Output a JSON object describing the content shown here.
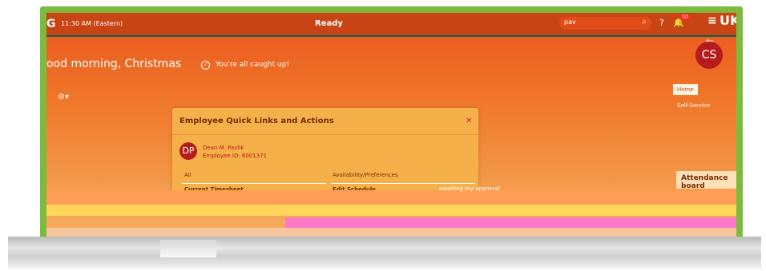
{
  "topbar": {
    "brand": "G",
    "time": "11:30 AM (Eastern)",
    "status": "Ready",
    "search_value": "pav",
    "notification_count": "10",
    "logo": "UK"
  },
  "greeting": "ood morning, Christmas",
  "caught_up": "You're all caught up!",
  "user": {
    "initials": "CS"
  },
  "tabs": [
    {
      "label": "Home"
    },
    {
      "label": "Self-Service"
    }
  ],
  "modal": {
    "title": "Employee Quick Links and Actions",
    "employee": {
      "initials": "DP",
      "name": "Dean M. Pavlik",
      "id_label": "Employee ID: 6001371"
    },
    "left_link": "All",
    "right_link": "Availability/Preferences",
    "current_timesheet": "Current Timesheet",
    "edit_schedule": "Edit Schedule"
  },
  "awaiting_text": "awaiting my approval",
  "attendance_title": "Attendance board",
  "colors": {
    "accent": "#c84414",
    "monitor": "#7dbb3f",
    "modal": "#f6b049",
    "avatar": "#b71c1c"
  }
}
